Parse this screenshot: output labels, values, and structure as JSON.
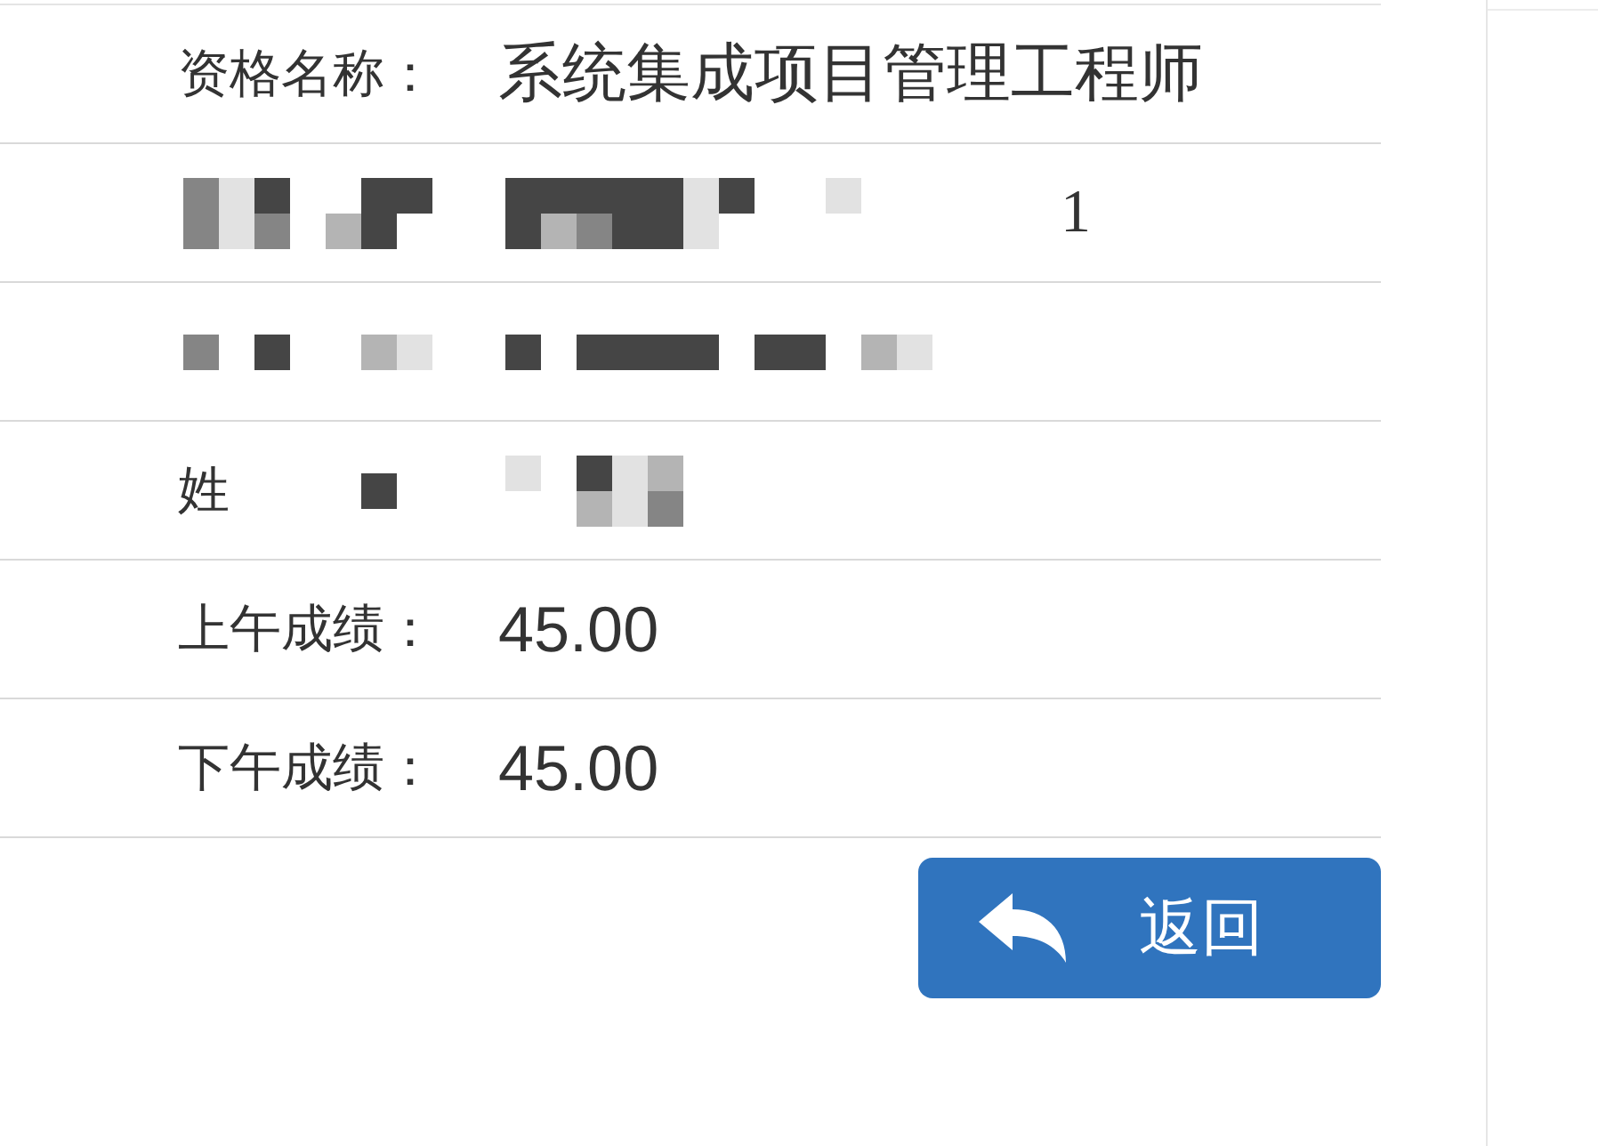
{
  "rows": [
    {
      "label": [
        {
          "kind": "text",
          "text": "资格名称："
        }
      ],
      "value": [
        {
          "kind": "text",
          "text": "系统集成项目管理工程师"
        }
      ]
    },
    {
      "label": [
        {
          "kind": "mosaic"
        }
      ],
      "value": [
        {
          "kind": "mosaic"
        },
        {
          "kind": "serif-text",
          "text": "1"
        }
      ]
    },
    {
      "label": [
        {
          "kind": "mosaic"
        }
      ],
      "value": [
        {
          "kind": "mosaic"
        }
      ]
    },
    {
      "label": [
        {
          "kind": "text",
          "text": "姓"
        },
        {
          "kind": "mosaic"
        }
      ],
      "value": [
        {
          "kind": "mosaic"
        }
      ]
    },
    {
      "label": [
        {
          "kind": "text",
          "text": "上午成绩："
        }
      ],
      "value": [
        {
          "kind": "text",
          "text": "45.00"
        }
      ]
    },
    {
      "label": [
        {
          "kind": "text",
          "text": "下午成绩："
        }
      ],
      "value": [
        {
          "kind": "text",
          "text": "45.00"
        }
      ]
    }
  ],
  "back_button": {
    "label": "返回"
  }
}
